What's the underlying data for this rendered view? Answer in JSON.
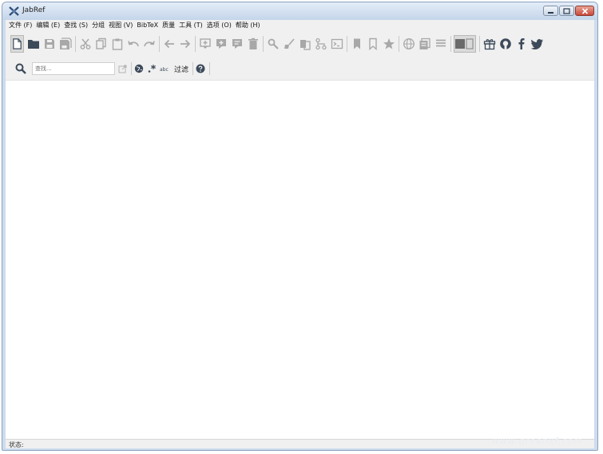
{
  "window": {
    "title": "JabRef"
  },
  "menubar": {
    "items": [
      "文件 (F)",
      "编辑 (E)",
      "查找 (S)",
      "分组",
      "视图 (V)",
      "BibTeX",
      "质量",
      "工具 (T)",
      "选项 (O)",
      "帮助 (H)"
    ]
  },
  "toolbar": {
    "icons": [
      "new-library-icon",
      "open-folder-icon",
      "save-icon",
      "save-all-icon",
      "cut-icon",
      "copy-icon",
      "paste-icon",
      "undo-icon",
      "redo-icon",
      "back-icon",
      "forward-icon",
      "new-entry-icon",
      "new-entry-from-text-icon",
      "edit-entry-icon",
      "delete-icon",
      "search-wrench-icon",
      "cleanup-icon",
      "merge-icon",
      "duplicates-icon",
      "terminal-icon",
      "bookmark-icon",
      "bookmark-outline-icon",
      "star-icon",
      "web-search-icon",
      "push-to-app-icon",
      "list-icon",
      "toggle-panel-icon",
      "gift-icon",
      "github-icon",
      "facebook-icon",
      "twitter-icon"
    ]
  },
  "searchbar": {
    "placeholder": "查找...",
    "filter_label": "过滤"
  },
  "statusbar": {
    "text": "状态:"
  },
  "watermark": "www.greenxf.com",
  "colors": {
    "titlebar": "#c4d5ea",
    "close_button": "#c8483a",
    "icon_gray": "#a8a8a8",
    "icon_dark": "#3c4a5a"
  }
}
